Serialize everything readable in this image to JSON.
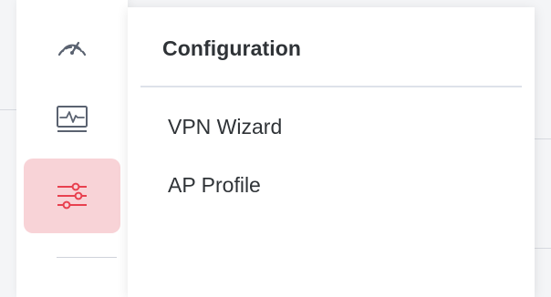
{
  "sidebar": {
    "items": [
      {
        "icon": "speedometer-icon",
        "active": false
      },
      {
        "icon": "monitor-pulse-icon",
        "active": false
      },
      {
        "icon": "sliders-icon",
        "active": true
      }
    ],
    "colors": {
      "icon": "#5a6270",
      "active_icon": "#e8404f",
      "active_bg": "#f8d3d7",
      "active_indicator": "#e8404f"
    }
  },
  "panel": {
    "title": "Configuration",
    "items": [
      {
        "label": "VPN Wizard"
      },
      {
        "label": "AP Profile"
      }
    ]
  }
}
